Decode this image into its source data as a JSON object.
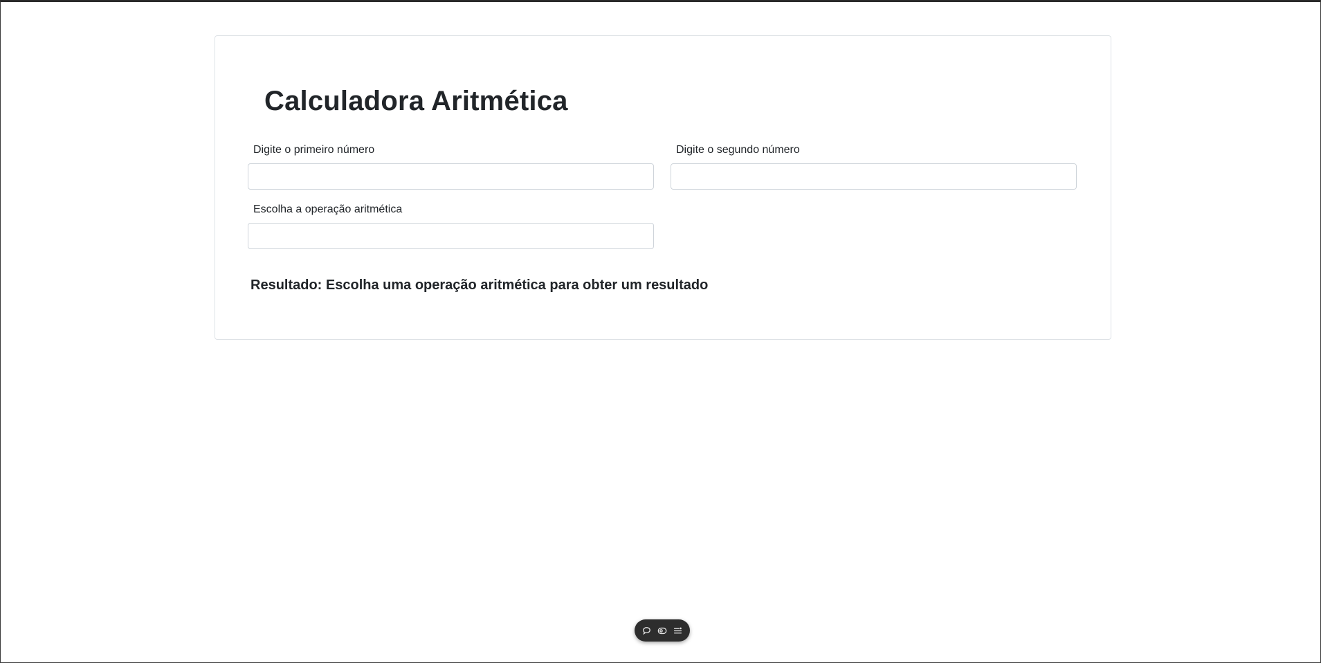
{
  "app": {
    "title": "Calculadora Aritmética"
  },
  "form": {
    "first_number": {
      "label": "Digite o primeiro número",
      "value": "",
      "placeholder": ""
    },
    "second_number": {
      "label": "Digite o segundo número",
      "value": "",
      "placeholder": ""
    },
    "operation": {
      "label": "Escolha a operação aritmética",
      "value": "",
      "placeholder": ""
    }
  },
  "result": {
    "text": "Resultado: Escolha uma operação aritmética para obter um resultado"
  },
  "toolbar": {
    "icons": [
      "comment-icon",
      "eye-icon",
      "menu-list-icon"
    ]
  },
  "colors": {
    "text": "#212529",
    "border": "#dee2e6",
    "input_border": "#ced4da",
    "toolbar_bg": "#2d2d2d",
    "toolbar_icon": "#e6e6e6"
  }
}
